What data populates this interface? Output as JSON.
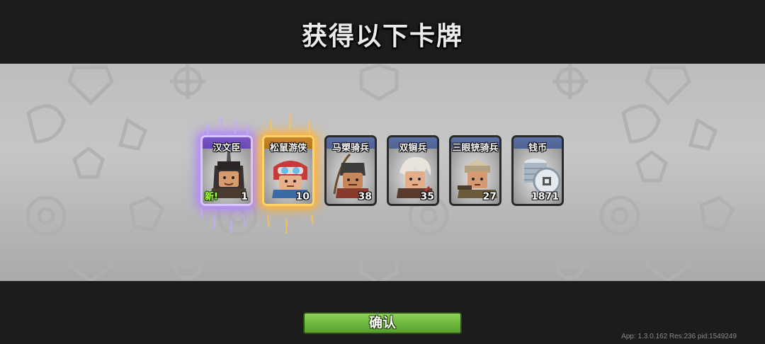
{
  "title": "获得以下卡牌",
  "cards": [
    {
      "name": "汉文臣",
      "count": "1",
      "badge": "新!",
      "frame": "purple"
    },
    {
      "name": "松鼠游侠",
      "count": "10",
      "frame": "gold"
    },
    {
      "name": "马槊骑兵",
      "count": "38",
      "frame": "blue"
    },
    {
      "name": "双锏兵",
      "count": "35",
      "frame": "blue"
    },
    {
      "name": "三眼铳骑兵",
      "count": "27",
      "frame": "blue"
    },
    {
      "name": "钱币",
      "count": "1871",
      "frame": "blue"
    }
  ],
  "confirm_label": "确认",
  "version_text": "App: 1.3.0.162 Res:236 pid:1549249"
}
